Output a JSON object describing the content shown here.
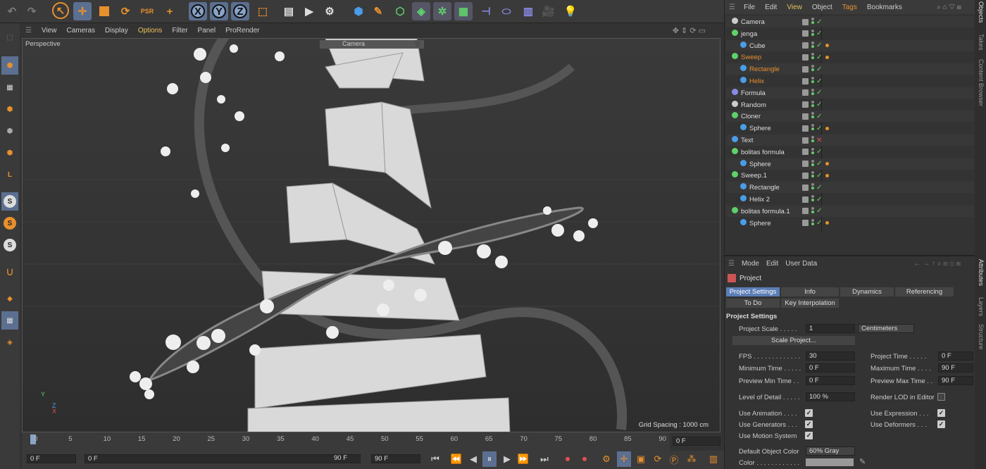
{
  "viewport_menu": [
    "View",
    "Cameras",
    "Display",
    "Options",
    "Filter",
    "Panel",
    "ProRender"
  ],
  "viewport_label": "Perspective",
  "camera_label": "Camera",
  "grid_spacing": "Grid Spacing : 1000 cm",
  "axis": {
    "y": "Y",
    "z": "Z",
    "x": "X"
  },
  "obj_menu": [
    "File",
    "Edit",
    "View",
    "Object",
    "Tags",
    "Bookmarks"
  ],
  "objects": [
    {
      "name": "Camera",
      "color": "#ddd",
      "icon": "camera"
    },
    {
      "name": "jenga",
      "color": "#ddd",
      "icon": "null"
    },
    {
      "name": "Cube",
      "color": "#ddd",
      "icon": "cube"
    },
    {
      "name": "Sweep",
      "color": "#e8902d",
      "icon": "sweep"
    },
    {
      "name": "Rectangle",
      "color": "#e8902d",
      "icon": "spline"
    },
    {
      "name": "Helix",
      "color": "#e8902d",
      "icon": "spline"
    },
    {
      "name": "Formula",
      "color": "#ddd",
      "icon": "formula"
    },
    {
      "name": "Random",
      "color": "#ddd",
      "icon": "random"
    },
    {
      "name": "Cloner",
      "color": "#ddd",
      "icon": "null"
    },
    {
      "name": "Sphere",
      "color": "#ddd",
      "icon": "sphere"
    },
    {
      "name": "Text",
      "color": "#ddd",
      "icon": "text"
    },
    {
      "name": "bolitas formula",
      "color": "#ddd",
      "icon": "null"
    },
    {
      "name": "Sphere",
      "color": "#ddd",
      "icon": "sphere"
    },
    {
      "name": "Sweep.1",
      "color": "#ddd",
      "icon": "sweep"
    },
    {
      "name": "Rectangle",
      "color": "#ddd",
      "icon": "spline"
    },
    {
      "name": "Helix 2",
      "color": "#ddd",
      "icon": "spline"
    },
    {
      "name": "bolitas formula.1",
      "color": "#ddd",
      "icon": "null"
    },
    {
      "name": "Sphere",
      "color": "#ddd",
      "icon": "sphere"
    }
  ],
  "right_tabs_top": [
    "Objects",
    "Takes",
    "Content Browser"
  ],
  "right_tabs_bottom": [
    "Attributes",
    "Layers",
    "Structure"
  ],
  "attr_menu": [
    "Mode",
    "Edit",
    "User Data"
  ],
  "attr_title": "Project",
  "attr_tabs": [
    "Project Settings",
    "Info",
    "Dynamics",
    "Referencing",
    "To Do",
    "Key Interpolation"
  ],
  "section": "Project Settings",
  "project_scale": {
    "label": "Project Scale . . . . .",
    "value": "1",
    "unit": "Centimeters"
  },
  "scale_button": "Scale Project...",
  "fields_left": [
    {
      "label": "FPS . . . . . . . . . . . . .",
      "value": "30"
    },
    {
      "label": "Minimum Time . . . . .",
      "value": "0 F"
    },
    {
      "label": "Preview Min Time . .",
      "value": "0 F"
    },
    {
      "label": "Level of Detail . . . . .",
      "value": "100 %"
    }
  ],
  "fields_right": [
    {
      "label": "Project Time . . . . .",
      "value": "0 F"
    },
    {
      "label": "Maximum Time . . . .",
      "value": "90 F"
    },
    {
      "label": "Preview Max Time . .",
      "value": "90 F"
    }
  ],
  "render_lod": "Render LOD in Editor",
  "checks_left": [
    "Use Animation . . . .",
    "Use Generators . . .",
    "Use Motion System"
  ],
  "checks_right": [
    "Use Expression . . .",
    "Use Deformers . . ."
  ],
  "default_color": {
    "label": "Default Object Color",
    "value": "60% Gray"
  },
  "color_label": "Color . . . . . . . . . . . .",
  "timeline_ticks": [
    "0",
    "5",
    "10",
    "15",
    "20",
    "25",
    "30",
    "35",
    "40",
    "45",
    "50",
    "55",
    "60",
    "65",
    "70",
    "75",
    "80",
    "85",
    "90"
  ],
  "current_frame": "0 F",
  "bottom": {
    "start": "0 F",
    "range_start": "0 F",
    "range_end": "90 F",
    "end": "90 F"
  },
  "playhead_fraction": 0.0
}
